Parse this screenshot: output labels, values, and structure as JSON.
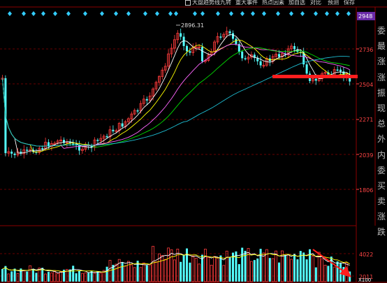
{
  "toolbar": {
    "tabs": [
      "大盘趋势线九转",
      "重大事件",
      "热点因素",
      "加自选",
      "对比",
      "预测",
      "保存"
    ]
  },
  "price_axis": {
    "current_price": "2948",
    "ticks": [
      "2736",
      "2504",
      "2271",
      "2039",
      "1806"
    ],
    "peak_label": "2896.31"
  },
  "volume_axis": {
    "ticks": [
      "4022",
      "2011"
    ],
    "unit": "X100"
  },
  "side_panel": {
    "chars": [
      "委",
      "最",
      "涨",
      "涨",
      "振",
      "现",
      "总",
      "外",
      "内",
      "委",
      "买",
      "卖",
      "涨",
      "跌"
    ]
  },
  "colors": {
    "up_candle": "#ff3c3c",
    "down_candle": "#54ffff",
    "ma5": "#ffffff",
    "ma10": "#ffff00",
    "ma20": "#ff66ff",
    "ma30": "#00dd00",
    "ma60": "#1dbbd0",
    "annotation": "#ff1e1e",
    "diamond": "#33ccff",
    "grid": "#8b0000"
  },
  "chart_data": {
    "type": "candlestick",
    "annotations": [
      "horizontal-support-line",
      "declining-volume-arrow"
    ]
  }
}
